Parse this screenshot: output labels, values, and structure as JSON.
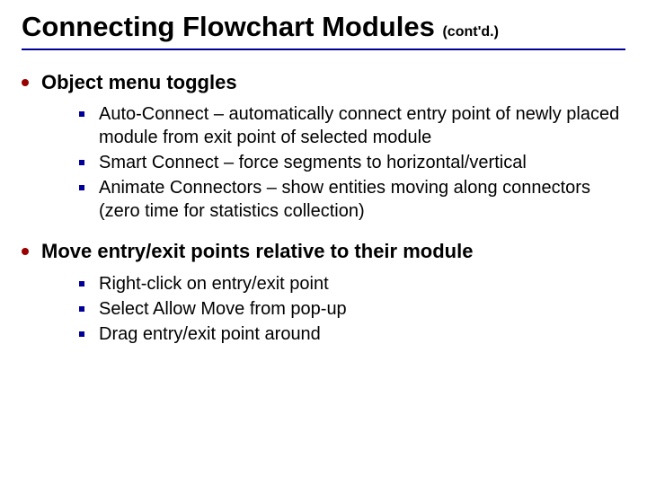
{
  "title": {
    "main": "Connecting Flowchart Modules",
    "suffix": "(cont'd.)"
  },
  "sections": [
    {
      "heading": "Object menu toggles",
      "items": [
        "Auto-Connect – automatically connect entry point of newly placed module from exit point of selected module",
        "Smart Connect – force segments to horizontal/vertical",
        "Animate Connectors – show entities moving along connectors (zero time for statistics collection)"
      ]
    },
    {
      "heading": "Move entry/exit points relative to their module",
      "items": [
        "Right-click on entry/exit point",
        "Select Allow Move from pop-up",
        "Drag entry/exit point around"
      ]
    }
  ]
}
